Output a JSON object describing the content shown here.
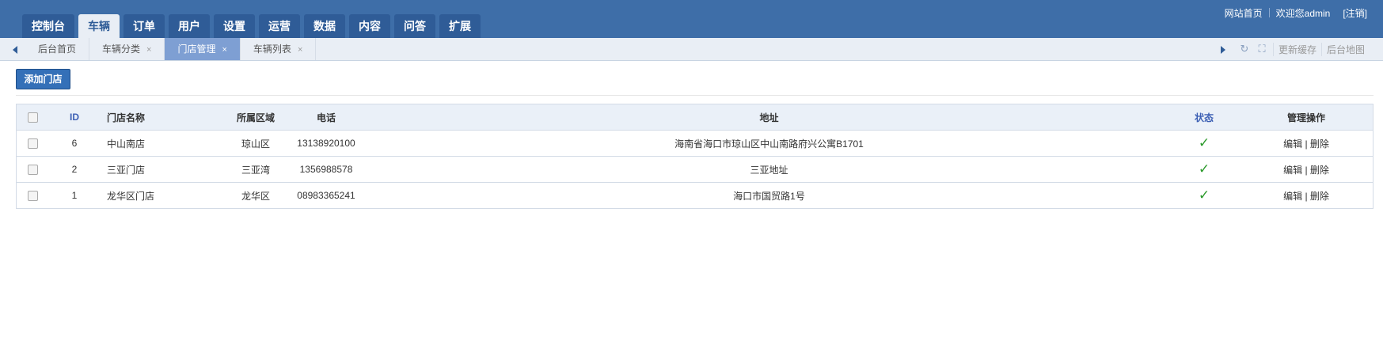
{
  "header": {
    "nav": [
      "控制台",
      "车辆",
      "订单",
      "用户",
      "设置",
      "运营",
      "数据",
      "内容",
      "问答",
      "扩展"
    ],
    "active_nav": 1,
    "links": {
      "home": "网站首页",
      "welcome": "欢迎您admin",
      "logout": "[注销]"
    }
  },
  "tabs": {
    "items": [
      "后台首页",
      "车辆分类",
      "门店管理",
      "车辆列表"
    ],
    "active": 2,
    "close": "×",
    "refresh_cache": "更新缓存",
    "sitemap": "后台地图"
  },
  "main": {
    "add_button": "添加门店",
    "table": {
      "headers": [
        "ID",
        "门店名称",
        "所属区域",
        "电话",
        "地址",
        "状态",
        "管理操作"
      ],
      "rows": [
        {
          "id": "6",
          "name": "中山南店",
          "area": "琼山区",
          "tel": "13138920100",
          "addr": "海南省海口市琼山区中山南路府兴公寓B1701",
          "status": "✓"
        },
        {
          "id": "2",
          "name": "三亚门店",
          "area": "三亚湾",
          "tel": "1356988578",
          "addr": "三亚地址",
          "status": "✓"
        },
        {
          "id": "1",
          "name": "龙华区门店",
          "area": "龙华区",
          "tel": "08983365241",
          "addr": "海口市国贸路1号",
          "status": "✓"
        }
      ],
      "edit": "编辑",
      "sep": "|",
      "delete": "删除"
    }
  },
  "colors": {
    "header": "#3e6ea8",
    "nav_tab": "#2f5c97",
    "active_tab": "#7e9fd3",
    "status_ok": "#2c9a2c"
  }
}
